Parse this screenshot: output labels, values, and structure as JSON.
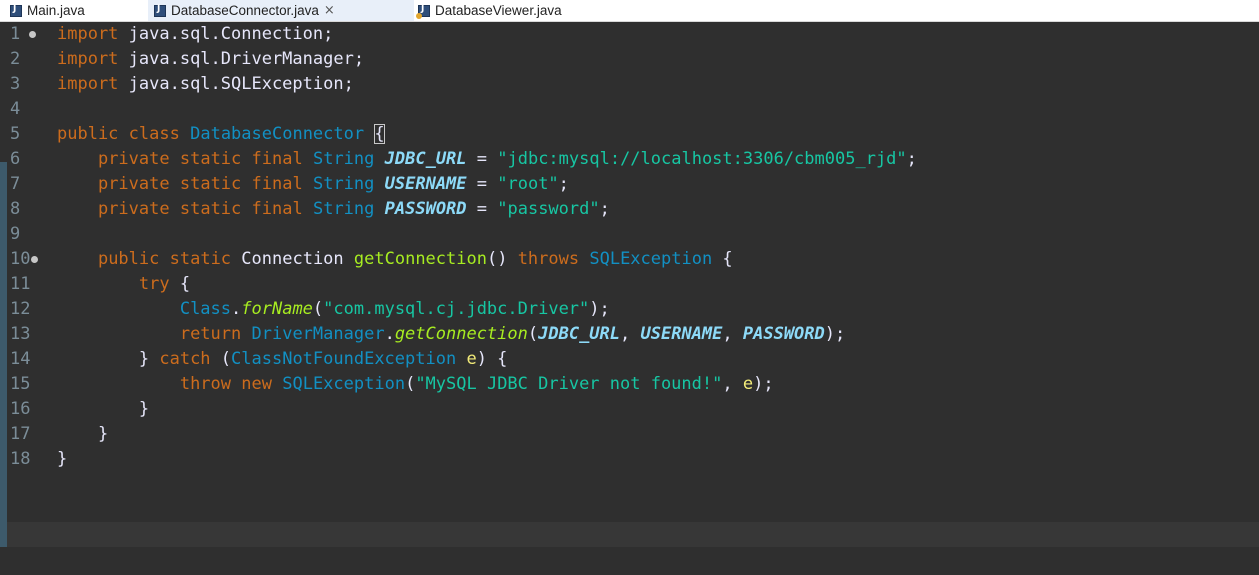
{
  "tabs": [
    {
      "label": "Main.java",
      "icon": "java-file-icon",
      "active": false
    },
    {
      "label": "DatabaseConnector.java",
      "icon": "java-file-icon",
      "active": true,
      "close": "×"
    },
    {
      "label": "DatabaseViewer.java",
      "icon": "java-run-icon",
      "active": false
    }
  ],
  "editor": {
    "current_line": 18,
    "lines": [
      {
        "n": "1",
        "code": [
          {
            "t": "import",
            "c": "kw"
          },
          {
            "t": " java.sql.Connection;",
            "c": "pl"
          }
        ]
      },
      {
        "n": "2",
        "code": [
          {
            "t": "import",
            "c": "kw"
          },
          {
            "t": " java.sql.DriverManager;",
            "c": "pl"
          }
        ]
      },
      {
        "n": "3",
        "code": [
          {
            "t": "import",
            "c": "kw"
          },
          {
            "t": " java.sql.SQLException;",
            "c": "pl"
          }
        ]
      },
      {
        "n": "4",
        "code": []
      },
      {
        "n": "5",
        "code": [
          {
            "t": "public",
            "c": "kw"
          },
          {
            "t": " ",
            "c": "pl"
          },
          {
            "t": "class",
            "c": "kw"
          },
          {
            "t": " ",
            "c": "pl"
          },
          {
            "t": "DatabaseConnector",
            "c": "cls"
          },
          {
            "t": " ",
            "c": "pl"
          },
          {
            "t": "{",
            "c": "pl",
            "match": true
          }
        ]
      },
      {
        "n": "6",
        "code": [
          {
            "t": "    ",
            "c": "pl"
          },
          {
            "t": "private",
            "c": "kw"
          },
          {
            "t": " ",
            "c": "pl"
          },
          {
            "t": "static",
            "c": "kw"
          },
          {
            "t": " ",
            "c": "pl"
          },
          {
            "t": "final",
            "c": "kw"
          },
          {
            "t": " ",
            "c": "pl"
          },
          {
            "t": "String",
            "c": "ty"
          },
          {
            "t": " ",
            "c": "pl"
          },
          {
            "t": "JDBC_URL",
            "c": "fld"
          },
          {
            "t": " = ",
            "c": "pl"
          },
          {
            "t": "\"jdbc:mysql://localhost:3306/cbm005_rjd\"",
            "c": "str"
          },
          {
            "t": ";",
            "c": "pl"
          }
        ]
      },
      {
        "n": "7",
        "code": [
          {
            "t": "    ",
            "c": "pl"
          },
          {
            "t": "private",
            "c": "kw"
          },
          {
            "t": " ",
            "c": "pl"
          },
          {
            "t": "static",
            "c": "kw"
          },
          {
            "t": " ",
            "c": "pl"
          },
          {
            "t": "final",
            "c": "kw"
          },
          {
            "t": " ",
            "c": "pl"
          },
          {
            "t": "String",
            "c": "ty"
          },
          {
            "t": " ",
            "c": "pl"
          },
          {
            "t": "USERNAME",
            "c": "fld"
          },
          {
            "t": " = ",
            "c": "pl"
          },
          {
            "t": "\"root\"",
            "c": "str"
          },
          {
            "t": ";",
            "c": "pl"
          }
        ]
      },
      {
        "n": "8",
        "code": [
          {
            "t": "    ",
            "c": "pl"
          },
          {
            "t": "private",
            "c": "kw"
          },
          {
            "t": " ",
            "c": "pl"
          },
          {
            "t": "static",
            "c": "kw"
          },
          {
            "t": " ",
            "c": "pl"
          },
          {
            "t": "final",
            "c": "kw"
          },
          {
            "t": " ",
            "c": "pl"
          },
          {
            "t": "String",
            "c": "ty"
          },
          {
            "t": " ",
            "c": "pl"
          },
          {
            "t": "PASSWORD",
            "c": "fld"
          },
          {
            "t": " = ",
            "c": "pl"
          },
          {
            "t": "\"password\"",
            "c": "str"
          },
          {
            "t": ";",
            "c": "pl"
          }
        ]
      },
      {
        "n": "9",
        "code": []
      },
      {
        "n": "10",
        "code": [
          {
            "t": "    ",
            "c": "pl"
          },
          {
            "t": "public",
            "c": "kw"
          },
          {
            "t": " ",
            "c": "pl"
          },
          {
            "t": "static",
            "c": "kw"
          },
          {
            "t": " ",
            "c": "pl"
          },
          {
            "t": "Connection",
            "c": "pl"
          },
          {
            "t": " ",
            "c": "pl"
          },
          {
            "t": "getConnection",
            "c": "mth"
          },
          {
            "t": "() ",
            "c": "pl"
          },
          {
            "t": "throws",
            "c": "kw"
          },
          {
            "t": " ",
            "c": "pl"
          },
          {
            "t": "SQLException",
            "c": "cls"
          },
          {
            "t": " {",
            "c": "pl"
          }
        ]
      },
      {
        "n": "11",
        "code": [
          {
            "t": "        ",
            "c": "pl"
          },
          {
            "t": "try",
            "c": "kw"
          },
          {
            "t": " {",
            "c": "pl"
          }
        ]
      },
      {
        "n": "12",
        "code": [
          {
            "t": "            ",
            "c": "pl"
          },
          {
            "t": "Class",
            "c": "cls"
          },
          {
            "t": ".",
            "c": "pl"
          },
          {
            "t": "forName",
            "c": "smth"
          },
          {
            "t": "(",
            "c": "pl"
          },
          {
            "t": "\"com.mysql.cj.jdbc.Driver\"",
            "c": "str"
          },
          {
            "t": ");",
            "c": "pl"
          }
        ]
      },
      {
        "n": "13",
        "code": [
          {
            "t": "            ",
            "c": "pl"
          },
          {
            "t": "return",
            "c": "kw"
          },
          {
            "t": " ",
            "c": "pl"
          },
          {
            "t": "DriverManager",
            "c": "cls"
          },
          {
            "t": ".",
            "c": "pl"
          },
          {
            "t": "getConnection",
            "c": "smth"
          },
          {
            "t": "(",
            "c": "pl"
          },
          {
            "t": "JDBC_URL",
            "c": "fld"
          },
          {
            "t": ", ",
            "c": "pl"
          },
          {
            "t": "USERNAME",
            "c": "fld"
          },
          {
            "t": ", ",
            "c": "pl"
          },
          {
            "t": "PASSWORD",
            "c": "fld"
          },
          {
            "t": ");",
            "c": "pl"
          }
        ]
      },
      {
        "n": "14",
        "code": [
          {
            "t": "        } ",
            "c": "pl"
          },
          {
            "t": "catch",
            "c": "kw"
          },
          {
            "t": " (",
            "c": "pl"
          },
          {
            "t": "ClassNotFoundException",
            "c": "cls"
          },
          {
            "t": " ",
            "c": "pl"
          },
          {
            "t": "e",
            "c": "loc"
          },
          {
            "t": ") {",
            "c": "pl"
          }
        ]
      },
      {
        "n": "15",
        "code": [
          {
            "t": "            ",
            "c": "pl"
          },
          {
            "t": "throw",
            "c": "kw"
          },
          {
            "t": " ",
            "c": "pl"
          },
          {
            "t": "new",
            "c": "kw"
          },
          {
            "t": " ",
            "c": "pl"
          },
          {
            "t": "SQLException",
            "c": "cls"
          },
          {
            "t": "(",
            "c": "pl"
          },
          {
            "t": "\"MySQL JDBC Driver not found!\"",
            "c": "str"
          },
          {
            "t": ", ",
            "c": "pl"
          },
          {
            "t": "e",
            "c": "loc"
          },
          {
            "t": ");",
            "c": "pl"
          }
        ]
      },
      {
        "n": "16",
        "code": [
          {
            "t": "        }",
            "c": "pl"
          }
        ]
      },
      {
        "n": "17",
        "code": [
          {
            "t": "    }",
            "c": "pl"
          }
        ]
      },
      {
        "n": "18",
        "code": [
          {
            "t": "}",
            "c": "pl"
          }
        ]
      }
    ]
  },
  "colors": {
    "background": "#2f2f2f",
    "keyword": "#cc6c1d",
    "type": "#1290c3",
    "string": "#17c6a3",
    "static_field": "#8ddaf8",
    "method": "#a7ec21",
    "local_variable": "#f3ec79",
    "line_number": "#7b8d98"
  }
}
